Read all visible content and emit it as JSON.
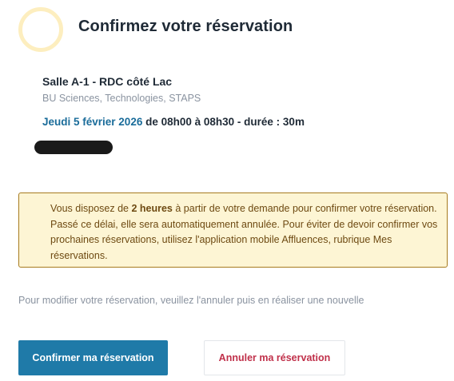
{
  "header": {
    "title": "Confirmez votre réservation"
  },
  "reservation": {
    "room": "Salle A-1 - RDC côté Lac",
    "library": "BU Sciences, Technologies, STAPS",
    "date": "Jeudi 5 février 2026",
    "time_details": " de 08h00 à 08h30 - durée : 30m"
  },
  "notice": {
    "prefix": "Vous disposez de ",
    "highlight": "2 heures",
    "suffix": " à partir de votre demande pour confirmer votre réservation. Passé ce délai, elle sera automatiquement annulée. Pour éviter de devoir confirmer vos prochaines réservations, utilisez l'application mobile Affluences, rubrique Mes réservations."
  },
  "hint": "Pour modifier votre réservation, veuillez l'annuler puis en réaliser une nouvelle",
  "actions": {
    "confirm_label": "Confirmer ma réservation",
    "cancel_label": "Annuler ma réservation"
  },
  "colors": {
    "accent": "#1f7aa8",
    "date_text": "#1a6c9a",
    "cancel_text": "#c0304a",
    "notice_bg": "#fdf5d4",
    "notice_border": "#a77b1f",
    "ring": "#fdeebf"
  }
}
